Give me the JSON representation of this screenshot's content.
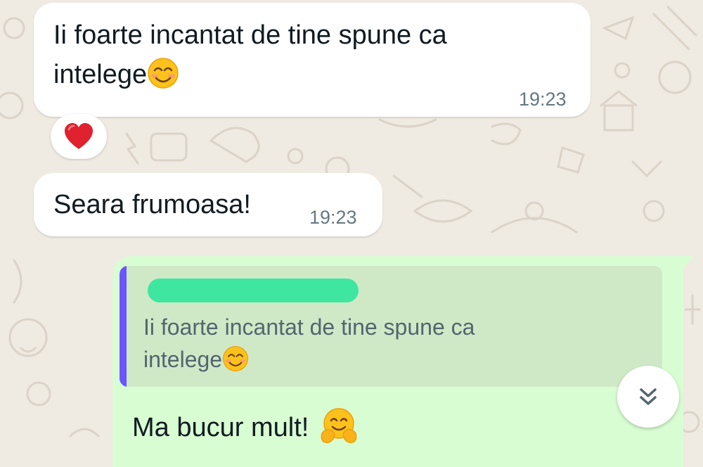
{
  "messages": [
    {
      "text_line1": "Ii foarte incantat de tine spune ca",
      "text_line2": "intelege",
      "emoji": "smiling-face-with-smiling-eyes",
      "time": "19:23",
      "reaction": "red-heart"
    },
    {
      "text": "Seara frumoasa!",
      "time": "19:23"
    }
  ],
  "outgoing": {
    "quote": {
      "author": "redacted",
      "text_line1": "Ii foarte incantat de tine spune ca",
      "text_line2": "intelege",
      "emoji": "smiling-face-with-smiling-eyes",
      "bar_color": "#6a55ff"
    },
    "text": "Ma bucur mult!",
    "emoji": "hugging-face"
  },
  "scroll_button": {
    "icon": "double-chevron-down-icon"
  },
  "colors": {
    "background": "#efeae2",
    "incoming": "#ffffff",
    "outgoing": "#d9fdd3",
    "quote_bg": "#cfe9c7",
    "redaction": "#3ee6a0"
  }
}
